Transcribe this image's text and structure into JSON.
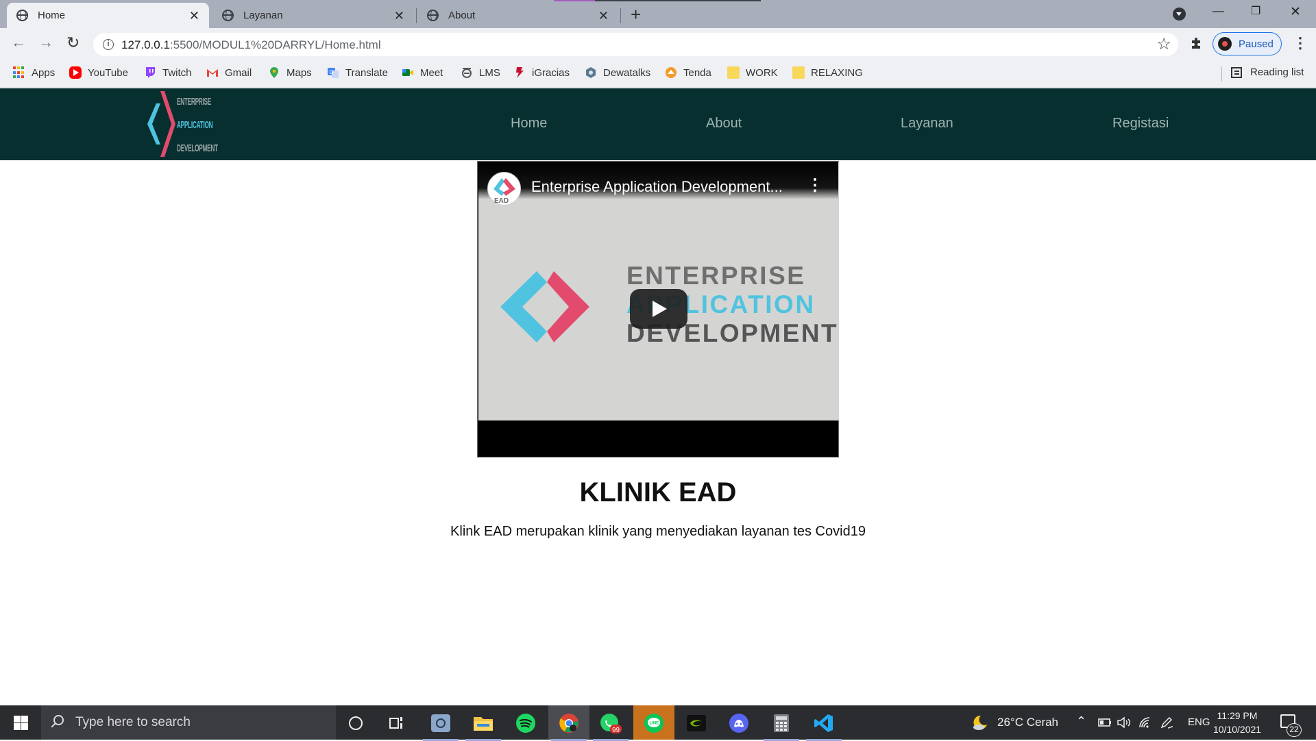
{
  "browser": {
    "tabs": [
      {
        "title": "Home",
        "active": true
      },
      {
        "title": "Layanan",
        "active": false
      },
      {
        "title": "About",
        "active": false
      }
    ],
    "url": {
      "host": "127.0.0.1",
      "rest": ":5500/MODUL1%20DARRYL/Home.html"
    },
    "profile_status": "Paused",
    "bookmarks": [
      {
        "label": "Apps",
        "icon": "apps-grid-icon"
      },
      {
        "label": "YouTube",
        "icon": "youtube-icon"
      },
      {
        "label": "Twitch",
        "icon": "twitch-icon"
      },
      {
        "label": "Gmail",
        "icon": "gmail-icon"
      },
      {
        "label": "Maps",
        "icon": "maps-icon"
      },
      {
        "label": "Translate",
        "icon": "translate-icon"
      },
      {
        "label": "Meet",
        "icon": "meet-icon"
      },
      {
        "label": "LMS",
        "icon": "lms-icon"
      },
      {
        "label": "iGracias",
        "icon": "igracias-icon"
      },
      {
        "label": "Dewatalks",
        "icon": "dewatalks-icon"
      },
      {
        "label": "Tenda",
        "icon": "tenda-icon"
      },
      {
        "label": "WORK",
        "icon": "folder-icon"
      },
      {
        "label": "RELAXING",
        "icon": "folder-icon"
      }
    ],
    "reading_list": "Reading list"
  },
  "site": {
    "logo_lines": [
      "ENTERPRISE",
      "APPLICATION",
      "DEVELOPMENT"
    ],
    "nav": [
      "Home",
      "About",
      "Layanan",
      "Registasi"
    ],
    "video": {
      "title": "Enterprise Application Development...",
      "channel_mark": "EAD",
      "thumb_lines": [
        "ENTERPRISE",
        "APPLICATION",
        "DEVELOPMENT"
      ]
    },
    "headline": "KLINIK EAD",
    "description": "Klink EAD merupakan klinik yang menyediakan layanan tes Covid19"
  },
  "taskbar": {
    "search_placeholder": "Type here to search",
    "weather": "26°C  Cerah",
    "language": "ENG",
    "time": "11:29 PM",
    "date": "10/10/2021",
    "whatsapp_badge": "99",
    "notification_count": "22"
  },
  "colors": {
    "site_nav_bg": "#082f30",
    "brand_blue": "#4fc3df",
    "brand_pink": "#e24b6d"
  }
}
